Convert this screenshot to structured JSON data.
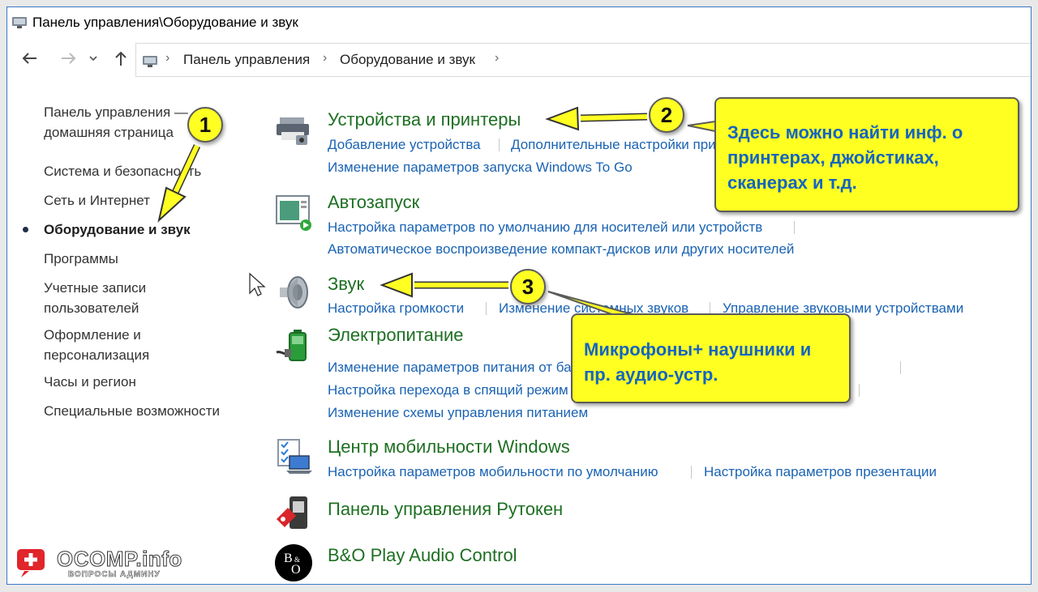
{
  "window": {
    "title": "Панель управления\\Оборудование и звук"
  },
  "nav": {
    "back_icon": "back-arrow-icon",
    "forward_icon": "forward-arrow-icon",
    "recent_icon": "chevron-down-icon",
    "up_icon": "up-arrow-icon",
    "breadcrumb": [
      "Панель управления",
      "Оборудование и звук"
    ]
  },
  "sidebar": {
    "items": [
      {
        "label_lines": [
          "Панель управления —",
          "домашняя страница"
        ]
      },
      {
        "label": "Система и безопасность"
      },
      {
        "label": "Сеть и Интернет"
      },
      {
        "label": "Оборудование и звук",
        "active": true
      },
      {
        "label": "Программы"
      },
      {
        "label_lines": [
          "Учетные записи",
          "пользователей"
        ]
      },
      {
        "label_lines": [
          "Оформление и",
          "персонализация"
        ]
      },
      {
        "label": "Часы и регион"
      },
      {
        "label": "Специальные возможности"
      }
    ]
  },
  "categories": [
    {
      "title": "Устройства и принтеры",
      "icon": "printer-icon",
      "tasks": [
        "Добавление устройства",
        "Дополнительные настройки принтера",
        "Изменение параметров запуска Windows To Go"
      ]
    },
    {
      "title": "Автозапуск",
      "icon": "autoplay-icon",
      "tasks": [
        "Настройка параметров по умолчанию для носителей или устройств",
        "Автоматическое воспроизведение компакт-дисков или других носителей"
      ]
    },
    {
      "title": "Звук",
      "icon": "speaker-icon",
      "tasks": [
        "Настройка громкости",
        "Изменение системных звуков",
        "Управление звуковыми устройствами"
      ]
    },
    {
      "title": "Электропитание",
      "icon": "battery-icon",
      "tasks": [
        "Изменение параметров питания от батареи",
        "Изменение параметров питания",
        "Настройка перехода в спящий режим",
        "Изменение схемы управления питанием"
      ]
    },
    {
      "title": "Центр мобильности Windows",
      "icon": "mobility-center-icon",
      "tasks": [
        "Настройка параметров мобильности по умолчанию",
        "Настройка параметров презентации"
      ]
    },
    {
      "title": "Панель управления Рутокен",
      "icon": "rutoken-icon",
      "tasks": []
    },
    {
      "title": "B&O Play Audio Control",
      "icon": "bo-logo-icon",
      "tasks": []
    }
  ],
  "annotations": {
    "badges": [
      "1",
      "2",
      "3"
    ],
    "callout_devices": "Здесь можно найти инф. о принтерах, джойстиках, сканерах и т.д.",
    "callout_sound": "Микрофоны+ наушники и пр. аудио-устр.",
    "callout_color": "#ffff22",
    "callout_text_color": "#1565c0"
  },
  "watermark": {
    "brand": "OCOMP.info",
    "tagline": "ВОПРОСЫ АДМИНУ"
  }
}
